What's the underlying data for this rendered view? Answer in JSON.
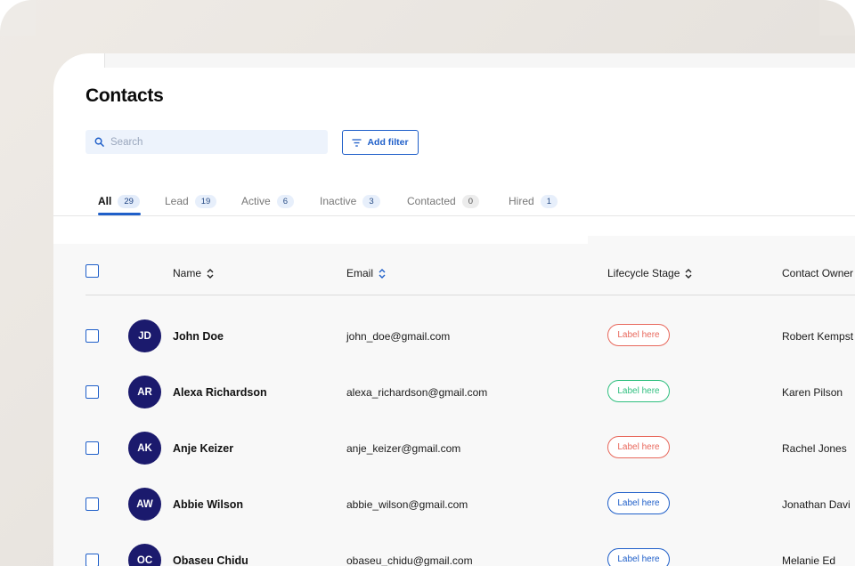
{
  "page": {
    "title": "Contacts"
  },
  "search": {
    "placeholder": "Search",
    "value": ""
  },
  "toolbar": {
    "add_filter_label": "Add filter"
  },
  "tabs": [
    {
      "label": "All",
      "count": "29",
      "active": true
    },
    {
      "label": "Lead",
      "count": "19"
    },
    {
      "label": "Active",
      "count": "6"
    },
    {
      "label": "Inactive",
      "count": "3"
    },
    {
      "label": "Contacted",
      "count": "0"
    },
    {
      "label": "Hired",
      "count": "1"
    }
  ],
  "table": {
    "columns": [
      "Name",
      "Email",
      "Lifecycle Stage",
      "Contact Owner"
    ],
    "rows": [
      {
        "initials": "JD",
        "name": "John Doe",
        "email": "john_doe@gmail.com",
        "stage_label": "Label here",
        "stage_color": "#e8685c",
        "owner": "Robert Kempst"
      },
      {
        "initials": "AR",
        "name": "Alexa Richardson",
        "email": "alexa_richardson@gmail.com",
        "stage_label": "Label here",
        "stage_color": "#2fbf7f",
        "owner": "Karen Pilson"
      },
      {
        "initials": "AK",
        "name": "Anje Keizer",
        "email": "anje_keizer@gmail.com",
        "stage_label": "Label here",
        "stage_color": "#e8685c",
        "owner": "Rachel Jones"
      },
      {
        "initials": "AW",
        "name": "Abbie Wilson",
        "email": "abbie_wilson@gmail.com",
        "stage_label": "Label here",
        "stage_color": "#1f5fc9",
        "owner": "Jonathan Davi"
      },
      {
        "initials": "OC",
        "name": "Obaseu Chidu",
        "email": "obaseu_chidu@gmail.com",
        "stage_label": "Label here",
        "stage_color": "#1f5fc9",
        "owner": "Melanie Ed"
      }
    ]
  },
  "colors": {
    "accent": "#1f5fc9",
    "avatar": "#1b1a6d",
    "search_bg": "#edf3fc"
  }
}
